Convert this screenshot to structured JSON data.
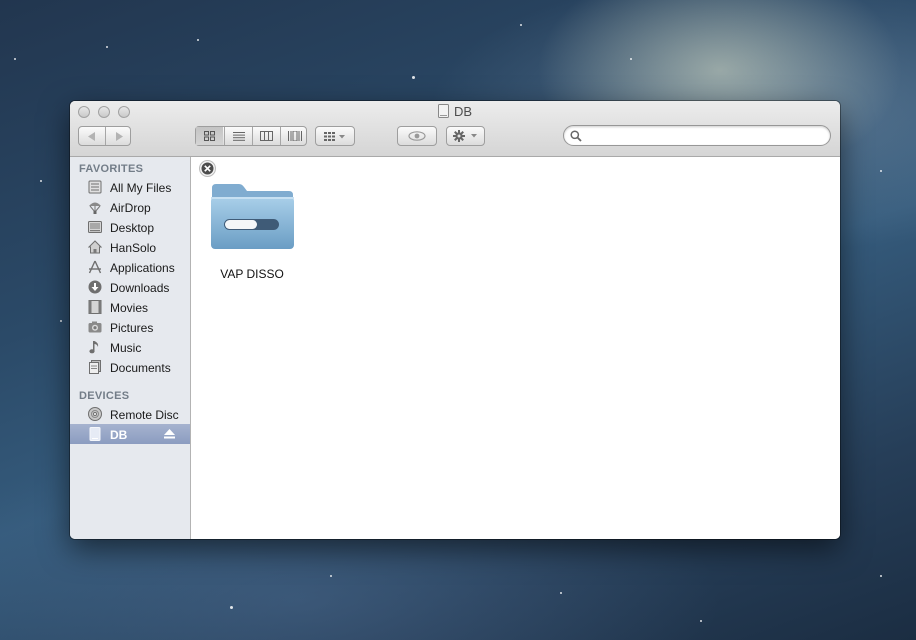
{
  "window": {
    "title": "DB",
    "traffic_lights": [
      "close",
      "minimize",
      "zoom"
    ]
  },
  "toolbar": {
    "back_icon": "back-arrow-icon",
    "forward_icon": "forward-arrow-icon",
    "view_modes": [
      "icon-view",
      "list-view",
      "column-view",
      "cover-flow-view"
    ],
    "active_view": "icon-view",
    "arrange_icon": "arrange-icon",
    "quick_look_icon": "eye-icon",
    "action_icon": "gear-icon",
    "search": {
      "placeholder": "",
      "value": ""
    }
  },
  "sidebar": {
    "favorites_header": "FAVORITES",
    "favorites": [
      {
        "label": "All My Files",
        "icon": "all-files-icon"
      },
      {
        "label": "AirDrop",
        "icon": "airdrop-icon"
      },
      {
        "label": "Desktop",
        "icon": "desktop-icon"
      },
      {
        "label": "HanSolo",
        "icon": "home-icon"
      },
      {
        "label": "Applications",
        "icon": "applications-icon"
      },
      {
        "label": "Downloads",
        "icon": "downloads-icon"
      },
      {
        "label": "Movies",
        "icon": "movies-icon"
      },
      {
        "label": "Pictures",
        "icon": "pictures-icon"
      },
      {
        "label": "Music",
        "icon": "music-icon"
      },
      {
        "label": "Documents",
        "icon": "documents-icon"
      }
    ],
    "devices_header": "DEVICES",
    "devices": [
      {
        "label": "Remote Disc",
        "icon": "remote-disc-icon"
      },
      {
        "label": "DB",
        "icon": "drive-icon",
        "selected": true,
        "eject_icon": "eject-icon"
      }
    ]
  },
  "content": {
    "items": [
      {
        "name": "VAP DISSO",
        "icon": "folder-icon",
        "badge": "remove-badge-icon"
      }
    ]
  },
  "colors": {
    "selection": "#8b9cc0",
    "sidebar_bg": "#e6e9ee",
    "folder": "#7fb0d6"
  }
}
